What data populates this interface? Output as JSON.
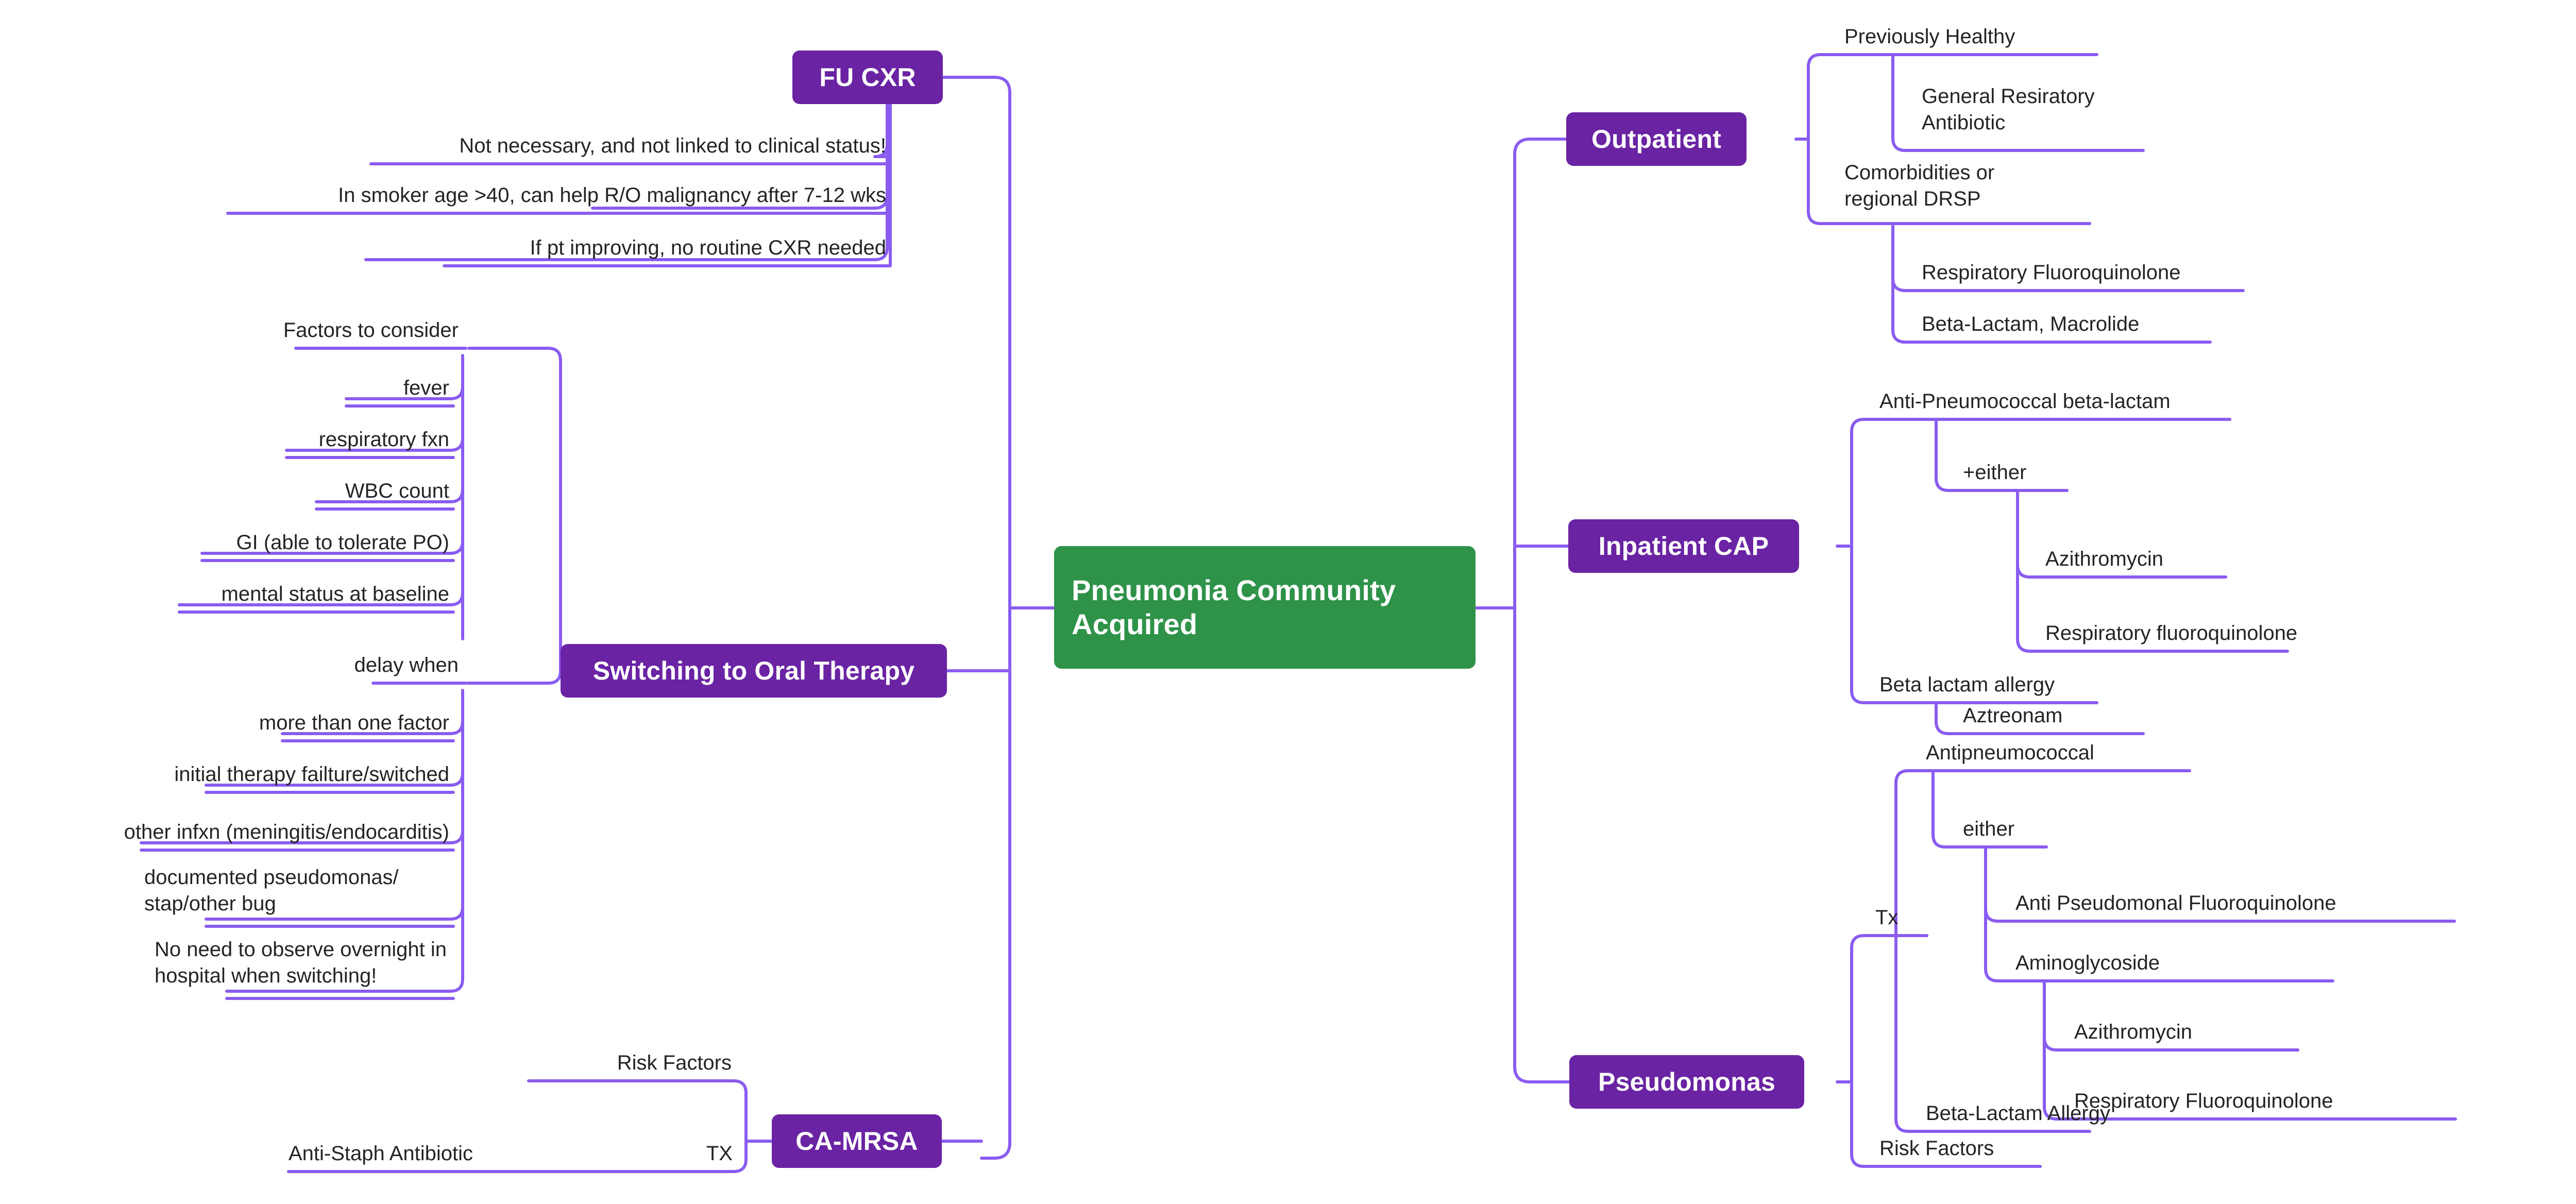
{
  "colors": {
    "root_fill": "#2e9349",
    "branch_fill": "#6a23a3",
    "connector": "#8a5cf0",
    "text": "#242424",
    "background": "#ffffff"
  },
  "root": {
    "label": "Pneumonia Community Acquired"
  },
  "branches": {
    "fu_cxr": {
      "label": "FU CXR",
      "children": [
        {
          "label": "Not necessary, and not linked to clinical status!"
        },
        {
          "label": "In smoker age >40, can help R/O malignancy after 7-12 wks"
        },
        {
          "label": "If pt improving, no routine CXR needed"
        }
      ]
    },
    "switching_to_oral_therapy": {
      "label": "Switching to Oral Therapy",
      "children": [
        {
          "label": "Factors to consider",
          "children": [
            {
              "label": "fever"
            },
            {
              "label": "respiratory fxn"
            },
            {
              "label": "WBC count"
            },
            {
              "label": "GI (able to tolerate PO)"
            },
            {
              "label": "mental status at baseline"
            }
          ]
        },
        {
          "label": "delay when",
          "children": [
            {
              "label": "more than one factor"
            },
            {
              "label": "initial therapy failture/switched"
            },
            {
              "label": "other infxn (meningitis/endocarditis)"
            },
            {
              "label": "documented pseudomonas/\nstap/other bug"
            },
            {
              "label": "No need to observe overnight in\nhospital when switching!"
            }
          ]
        }
      ]
    },
    "ca_mrsa": {
      "label": "CA-MRSA",
      "children": [
        {
          "label": "Risk Factors"
        },
        {
          "label": "TX",
          "children": [
            {
              "label": "Anti-Staph Antibiotic"
            }
          ]
        }
      ]
    },
    "outpatient": {
      "label": "Outpatient",
      "children": [
        {
          "label": "Previously Healthy",
          "children": [
            {
              "label": "General Resiratory\nAntibiotic"
            }
          ]
        },
        {
          "label": "Comorbidities or\nregional DRSP",
          "children": [
            {
              "label": "Respiratory Fluoroquinolone"
            },
            {
              "label": "Beta-Lactam, Macrolide"
            }
          ]
        }
      ]
    },
    "inpatient_cap": {
      "label": "Inpatient CAP",
      "children": [
        {
          "label": "Anti-Pneumococcal beta-lactam",
          "children": [
            {
              "label": "+either",
              "children": [
                {
                  "label": "Azithromycin"
                },
                {
                  "label": "Respiratory fluoroquinolone"
                }
              ]
            }
          ]
        },
        {
          "label": "Beta lactam allergy",
          "children": [
            {
              "label": "Aztreonam"
            }
          ]
        }
      ]
    },
    "pseudomonas": {
      "label": "Pseudomonas",
      "children": [
        {
          "label": "Tx",
          "children": [
            {
              "label": "Antipneumococcal",
              "children": [
                {
                  "label": "either",
                  "children": [
                    {
                      "label": "Anti Pseudomonal Fluoroquinolone"
                    },
                    {
                      "label": "Aminoglycoside",
                      "children": [
                        {
                          "label": "Azithromycin"
                        },
                        {
                          "label": "Respiratory Fluoroquinolone"
                        }
                      ]
                    }
                  ]
                }
              ]
            },
            {
              "label": "Beta-Lactam Allergy"
            }
          ]
        },
        {
          "label": "Risk Factors"
        }
      ]
    }
  }
}
